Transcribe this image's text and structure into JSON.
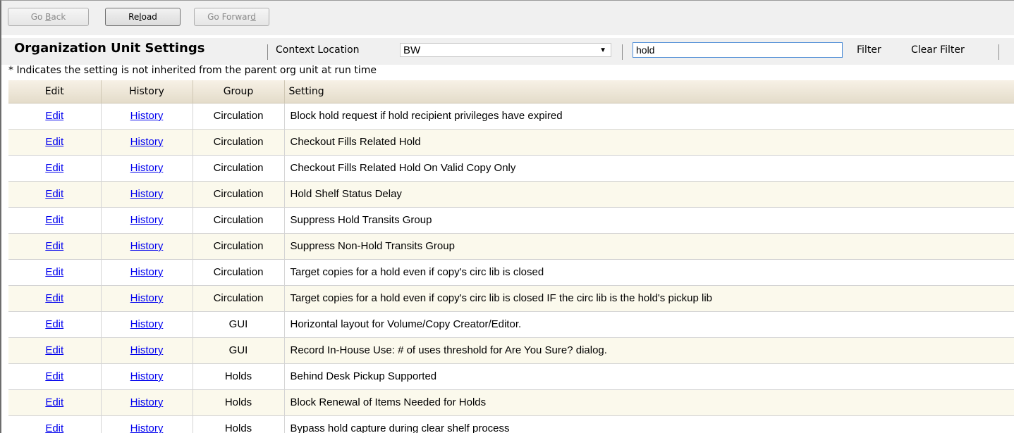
{
  "nav": {
    "back": {
      "pre": "Go ",
      "key": "B",
      "post": "ack"
    },
    "reload": {
      "pre": "Re",
      "key": "l",
      "post": "oad"
    },
    "forward": {
      "pre": "Go Forwar",
      "key": "d",
      "post": ""
    }
  },
  "header": {
    "title": "Organization Unit Settings",
    "context_label": "Context Location",
    "context_value": "BW",
    "filter_value": "hold",
    "filter_button": "Filter",
    "clear_filter_button": "Clear Filter"
  },
  "note": "* Indicates the setting is not inherited from the parent org unit at run time",
  "columns": [
    "Edit",
    "History",
    "Group",
    "Setting"
  ],
  "rows": [
    {
      "edit": "Edit",
      "history": "History",
      "group": "Circulation",
      "setting": "Block hold request if hold recipient privileges have expired"
    },
    {
      "edit": "Edit",
      "history": "History",
      "group": "Circulation",
      "setting": "Checkout Fills Related Hold"
    },
    {
      "edit": "Edit",
      "history": "History",
      "group": "Circulation",
      "setting": "Checkout Fills Related Hold On Valid Copy Only"
    },
    {
      "edit": "Edit",
      "history": "History",
      "group": "Circulation",
      "setting": "Hold Shelf Status Delay"
    },
    {
      "edit": "Edit",
      "history": "History",
      "group": "Circulation",
      "setting": "Suppress Hold Transits Group"
    },
    {
      "edit": "Edit",
      "history": "History",
      "group": "Circulation",
      "setting": "Suppress Non-Hold Transits Group"
    },
    {
      "edit": "Edit",
      "history": "History",
      "group": "Circulation",
      "setting": "Target copies for a hold even if copy's circ lib is closed"
    },
    {
      "edit": "Edit",
      "history": "History",
      "group": "Circulation",
      "setting": "Target copies for a hold even if copy's circ lib is closed IF the circ lib is the hold's pickup lib"
    },
    {
      "edit": "Edit",
      "history": "History",
      "group": "GUI",
      "setting": "Horizontal layout for Volume/Copy Creator/Editor."
    },
    {
      "edit": "Edit",
      "history": "History",
      "group": "GUI",
      "setting": "Record In-House Use: # of uses threshold for Are You Sure? dialog."
    },
    {
      "edit": "Edit",
      "history": "History",
      "group": "Holds",
      "setting": "Behind Desk Pickup Supported"
    },
    {
      "edit": "Edit",
      "history": "History",
      "group": "Holds",
      "setting": "Block Renewal of Items Needed for Holds"
    },
    {
      "edit": "Edit",
      "history": "History",
      "group": "Holds",
      "setting": "Bypass hold capture during clear shelf process"
    }
  ]
}
